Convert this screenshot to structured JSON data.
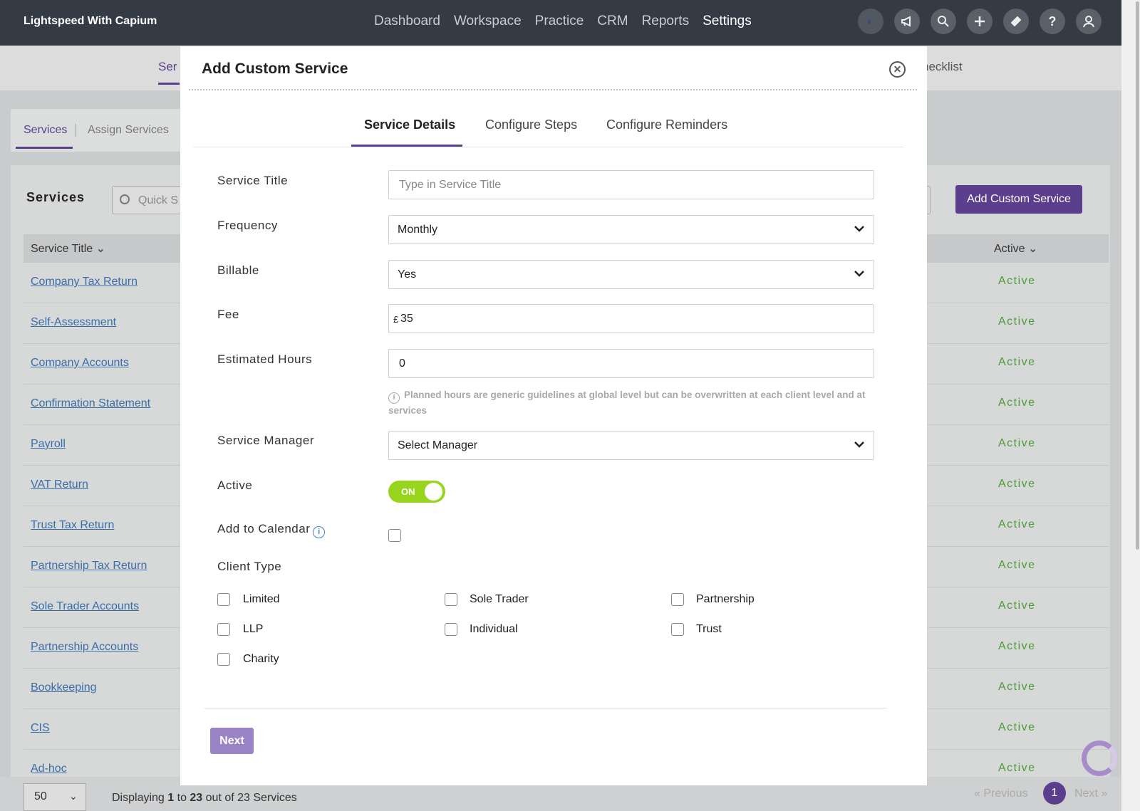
{
  "app": {
    "brand": "Lightspeed With Capium",
    "nav": [
      "Dashboard",
      "Workspace",
      "Practice",
      "CRM",
      "Reports",
      "Settings"
    ],
    "active_nav": "Settings",
    "header_icons": [
      "capium-logo-icon",
      "megaphone-icon",
      "search-icon",
      "plus-icon",
      "ticket-icon",
      "help-icon",
      "user-icon"
    ]
  },
  "background": {
    "subnav_partial": "Ser",
    "subnav_right_partial": "hecklist",
    "tabs": [
      "Services",
      "Assign Services"
    ],
    "section_title": "Services",
    "search_placeholder": "Quick S",
    "add_button": "Add Custom Service",
    "columns": {
      "title": "Service Title",
      "active": "Active"
    },
    "rows": [
      {
        "name": "Company Tax Return",
        "status": "Active"
      },
      {
        "name": "Self-Assessment",
        "status": "Active"
      },
      {
        "name": "Company Accounts",
        "status": "Active"
      },
      {
        "name": "Confirmation Statement",
        "status": "Active"
      },
      {
        "name": "Payroll",
        "status": "Active"
      },
      {
        "name": "VAT Return",
        "status": "Active"
      },
      {
        "name": "Trust Tax Return",
        "status": "Active"
      },
      {
        "name": "Partnership Tax Return",
        "status": "Active"
      },
      {
        "name": "Sole Trader Accounts",
        "status": "Active"
      },
      {
        "name": "Partnership Accounts",
        "status": "Active"
      },
      {
        "name": "Bookkeeping",
        "status": "Active"
      },
      {
        "name": "CIS",
        "status": "Active"
      },
      {
        "name": "Ad-hoc",
        "status": "Active"
      }
    ],
    "page_size": "50",
    "display": {
      "prefix": "Displaying ",
      "from": "1",
      "mid": " to ",
      "to": "23",
      "suffix": " out of 23 Services"
    },
    "pagination": {
      "prev": "«  Previous",
      "current": "1",
      "next": "Next  »"
    },
    "accent": "#5c3f8c"
  },
  "modal": {
    "title": "Add Custom Service",
    "tabs": [
      "Service Details",
      "Configure Steps",
      "Configure Reminders"
    ],
    "fields": {
      "service_title": {
        "label": "Service Title",
        "placeholder": "Type in Service Title",
        "value": ""
      },
      "frequency": {
        "label": "Frequency",
        "value": "Monthly"
      },
      "billable": {
        "label": "Billable",
        "value": "Yes"
      },
      "fee": {
        "label": "Fee",
        "currency": "£",
        "value": "35"
      },
      "estimated_hours": {
        "label": "Estimated Hours",
        "value": "0"
      },
      "hint": "Planned hours are generic guidelines at global level but can be overwritten at each client level and at services",
      "service_manager": {
        "label": "Service Manager",
        "value": "Select Manager"
      },
      "active": {
        "label": "Active",
        "toggle": "ON",
        "on": true
      },
      "add_to_calendar": {
        "label": "Add to Calendar",
        "checked": false
      },
      "client_type": {
        "label": "Client Type",
        "options": [
          "Limited",
          "Sole Trader",
          "Partnership",
          "LLP",
          "Individual",
          "Trust",
          "Charity"
        ]
      }
    },
    "next_button": "Next",
    "toggle_color": "#97d51c"
  }
}
